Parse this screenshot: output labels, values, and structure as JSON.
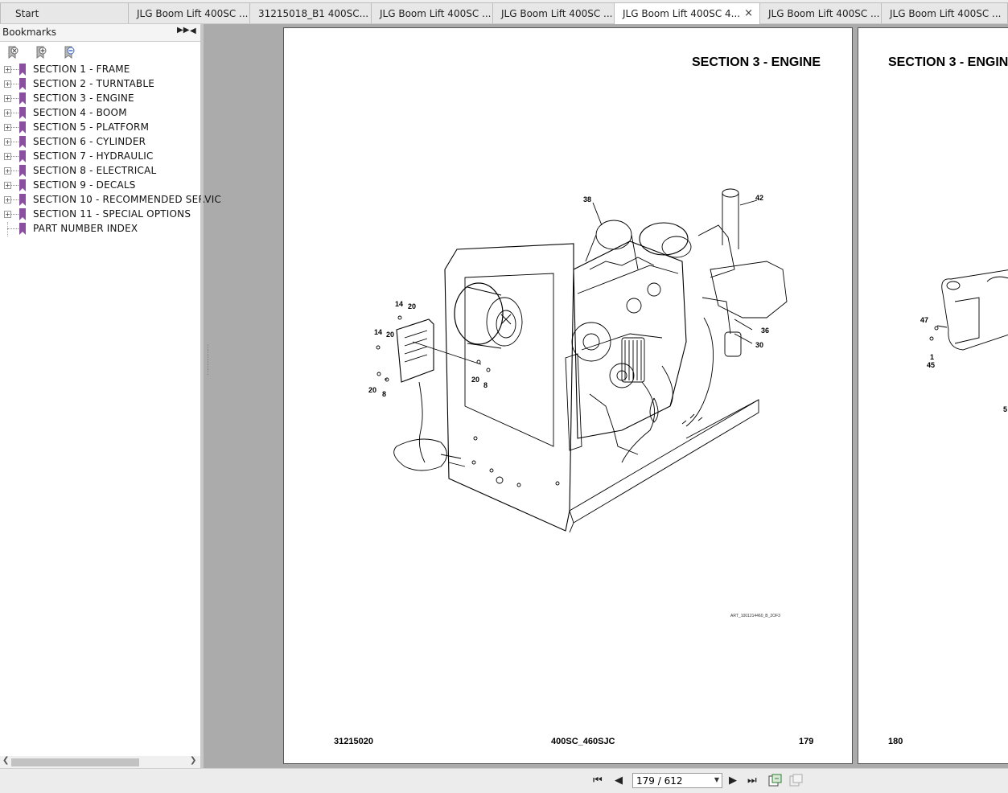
{
  "tabs": [
    {
      "label": "Start"
    },
    {
      "label": "JLG Boom Lift 400SC ..."
    },
    {
      "label": "31215018_B1 400SC..."
    },
    {
      "label": "JLG Boom Lift 400SC ..."
    },
    {
      "label": "JLG Boom Lift 400SC ..."
    },
    {
      "label": "JLG Boom Lift 400SC 4...",
      "active": true,
      "close": "×"
    },
    {
      "label": "JLG Boom Lift 400SC ..."
    },
    {
      "label": "JLG Boom Lift 400SC ..."
    }
  ],
  "sidebar": {
    "title": "Bookmarks",
    "expand_icon": "double-chevron-right-icon",
    "collapse_icon": "triangle-left-icon",
    "tools": [
      "bookmark-delete-icon",
      "bookmark-add-icon",
      "bookmark-find-icon"
    ],
    "items": [
      {
        "label": "SECTION 1 - FRAME",
        "expandable": true
      },
      {
        "label": "SECTION 2 - TURNTABLE",
        "expandable": true
      },
      {
        "label": "SECTION 3 - ENGINE",
        "expandable": true
      },
      {
        "label": "SECTION 4 - BOOM",
        "expandable": true
      },
      {
        "label": "SECTION 5 - PLATFORM",
        "expandable": true
      },
      {
        "label": "SECTION 6 - CYLINDER",
        "expandable": true
      },
      {
        "label": "SECTION 7 - HYDRAULIC",
        "expandable": true
      },
      {
        "label": "SECTION 8 - ELECTRICAL",
        "expandable": true
      },
      {
        "label": "SECTION 9 - DECALS",
        "expandable": true
      },
      {
        "label": "SECTION 10 - RECOMMENDED SERVIC",
        "expandable": true
      },
      {
        "label": "SECTION 11 - SPECIAL OPTIONS",
        "expandable": true
      },
      {
        "label": "PART NUMBER INDEX",
        "expandable": false
      }
    ]
  },
  "page179": {
    "section_title": "SECTION 3 - ENGINE",
    "art_ref": "ART_1001214460_B_2OF3",
    "footer_left": "31215020",
    "footer_center": "400SC_460SJC",
    "footer_right": "179",
    "callouts": {
      "c38": "38",
      "c42": "42",
      "c36": "36",
      "c30": "30",
      "c14a": "14",
      "c20a": "20",
      "c14b": "14",
      "c20b": "20",
      "c20c": "20",
      "c8a": "8",
      "c20d": "20",
      "c8b": "8"
    }
  },
  "page180": {
    "section_title": "SECTION 3 - ENGIN",
    "footer_left": "180",
    "callouts": {
      "c47": "47",
      "c1": "1",
      "c45": "45",
      "c5": "5"
    }
  },
  "navigation": {
    "page_indicator": "179 / 612",
    "icons": [
      "first-page-icon",
      "previous-page-icon",
      "next-page-icon",
      "last-page-icon",
      "continuous-view-icon",
      "facing-view-icon"
    ]
  }
}
